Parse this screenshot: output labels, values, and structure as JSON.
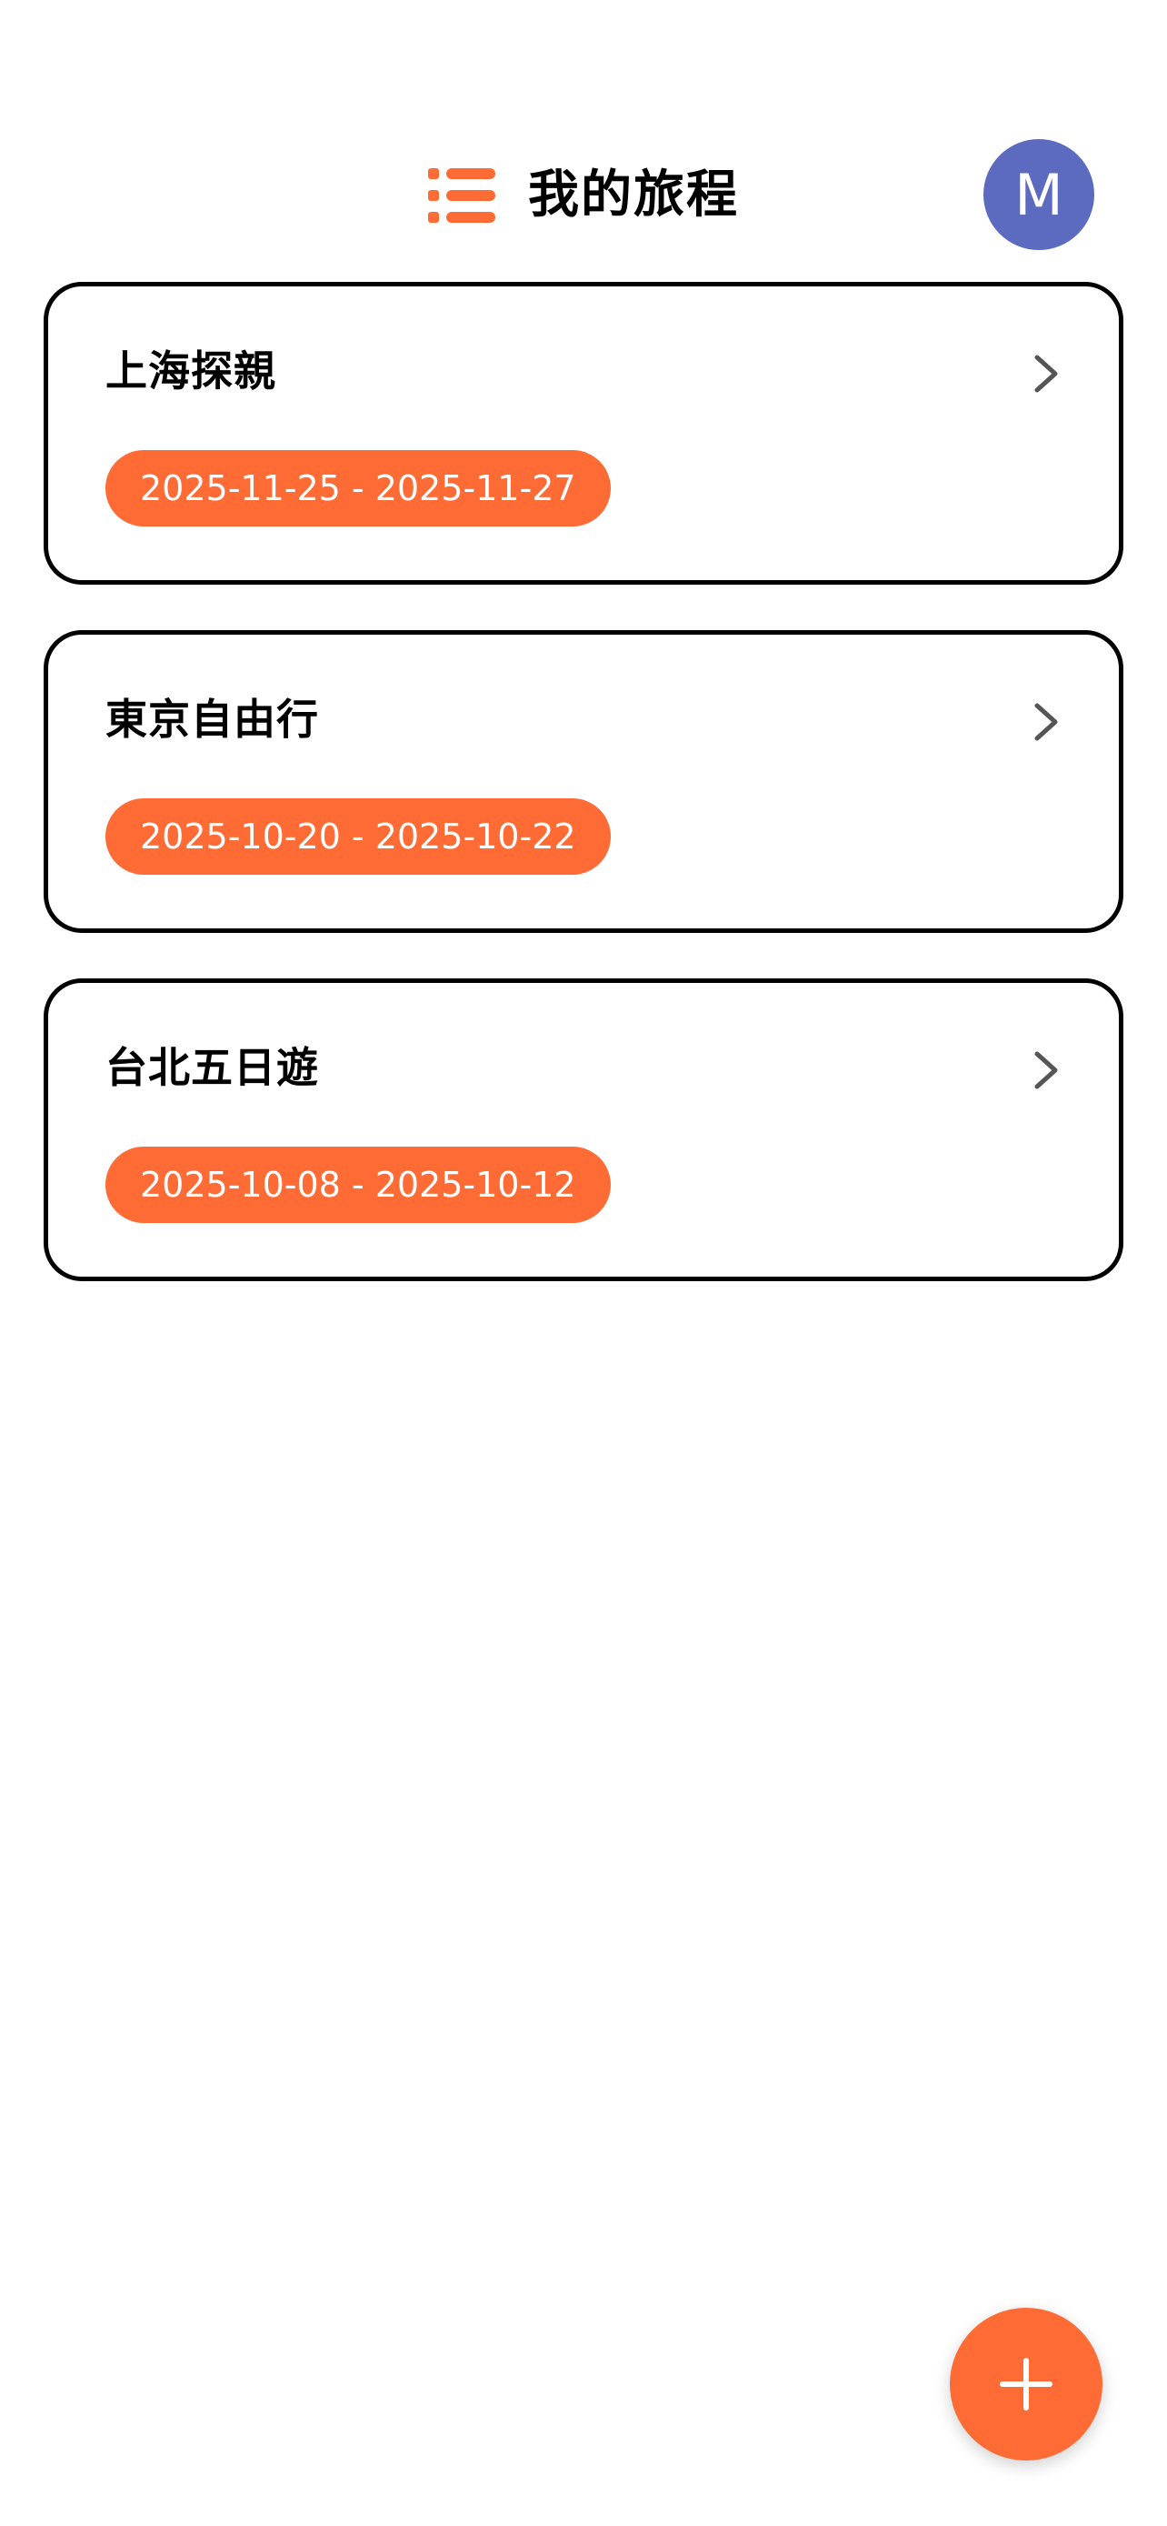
{
  "header": {
    "title": "我的旅程",
    "menu_icon": "list-icon",
    "avatar_initial": "M"
  },
  "trips": [
    {
      "title": "上海探親",
      "date_range": "2025-11-25 - 2025-11-27"
    },
    {
      "title": "東京自由行",
      "date_range": "2025-10-20 - 2025-10-22"
    },
    {
      "title": "台北五日遊",
      "date_range": "2025-10-08 - 2025-10-12"
    }
  ],
  "icons": {
    "card_arrow": "chevron-right-icon",
    "fab": "plus-icon"
  },
  "colors": {
    "accent": "#FF6B35",
    "avatar_bg": "#5C6BC0",
    "card_border": "#000000",
    "chevron": "#555555",
    "text": "#000000"
  }
}
